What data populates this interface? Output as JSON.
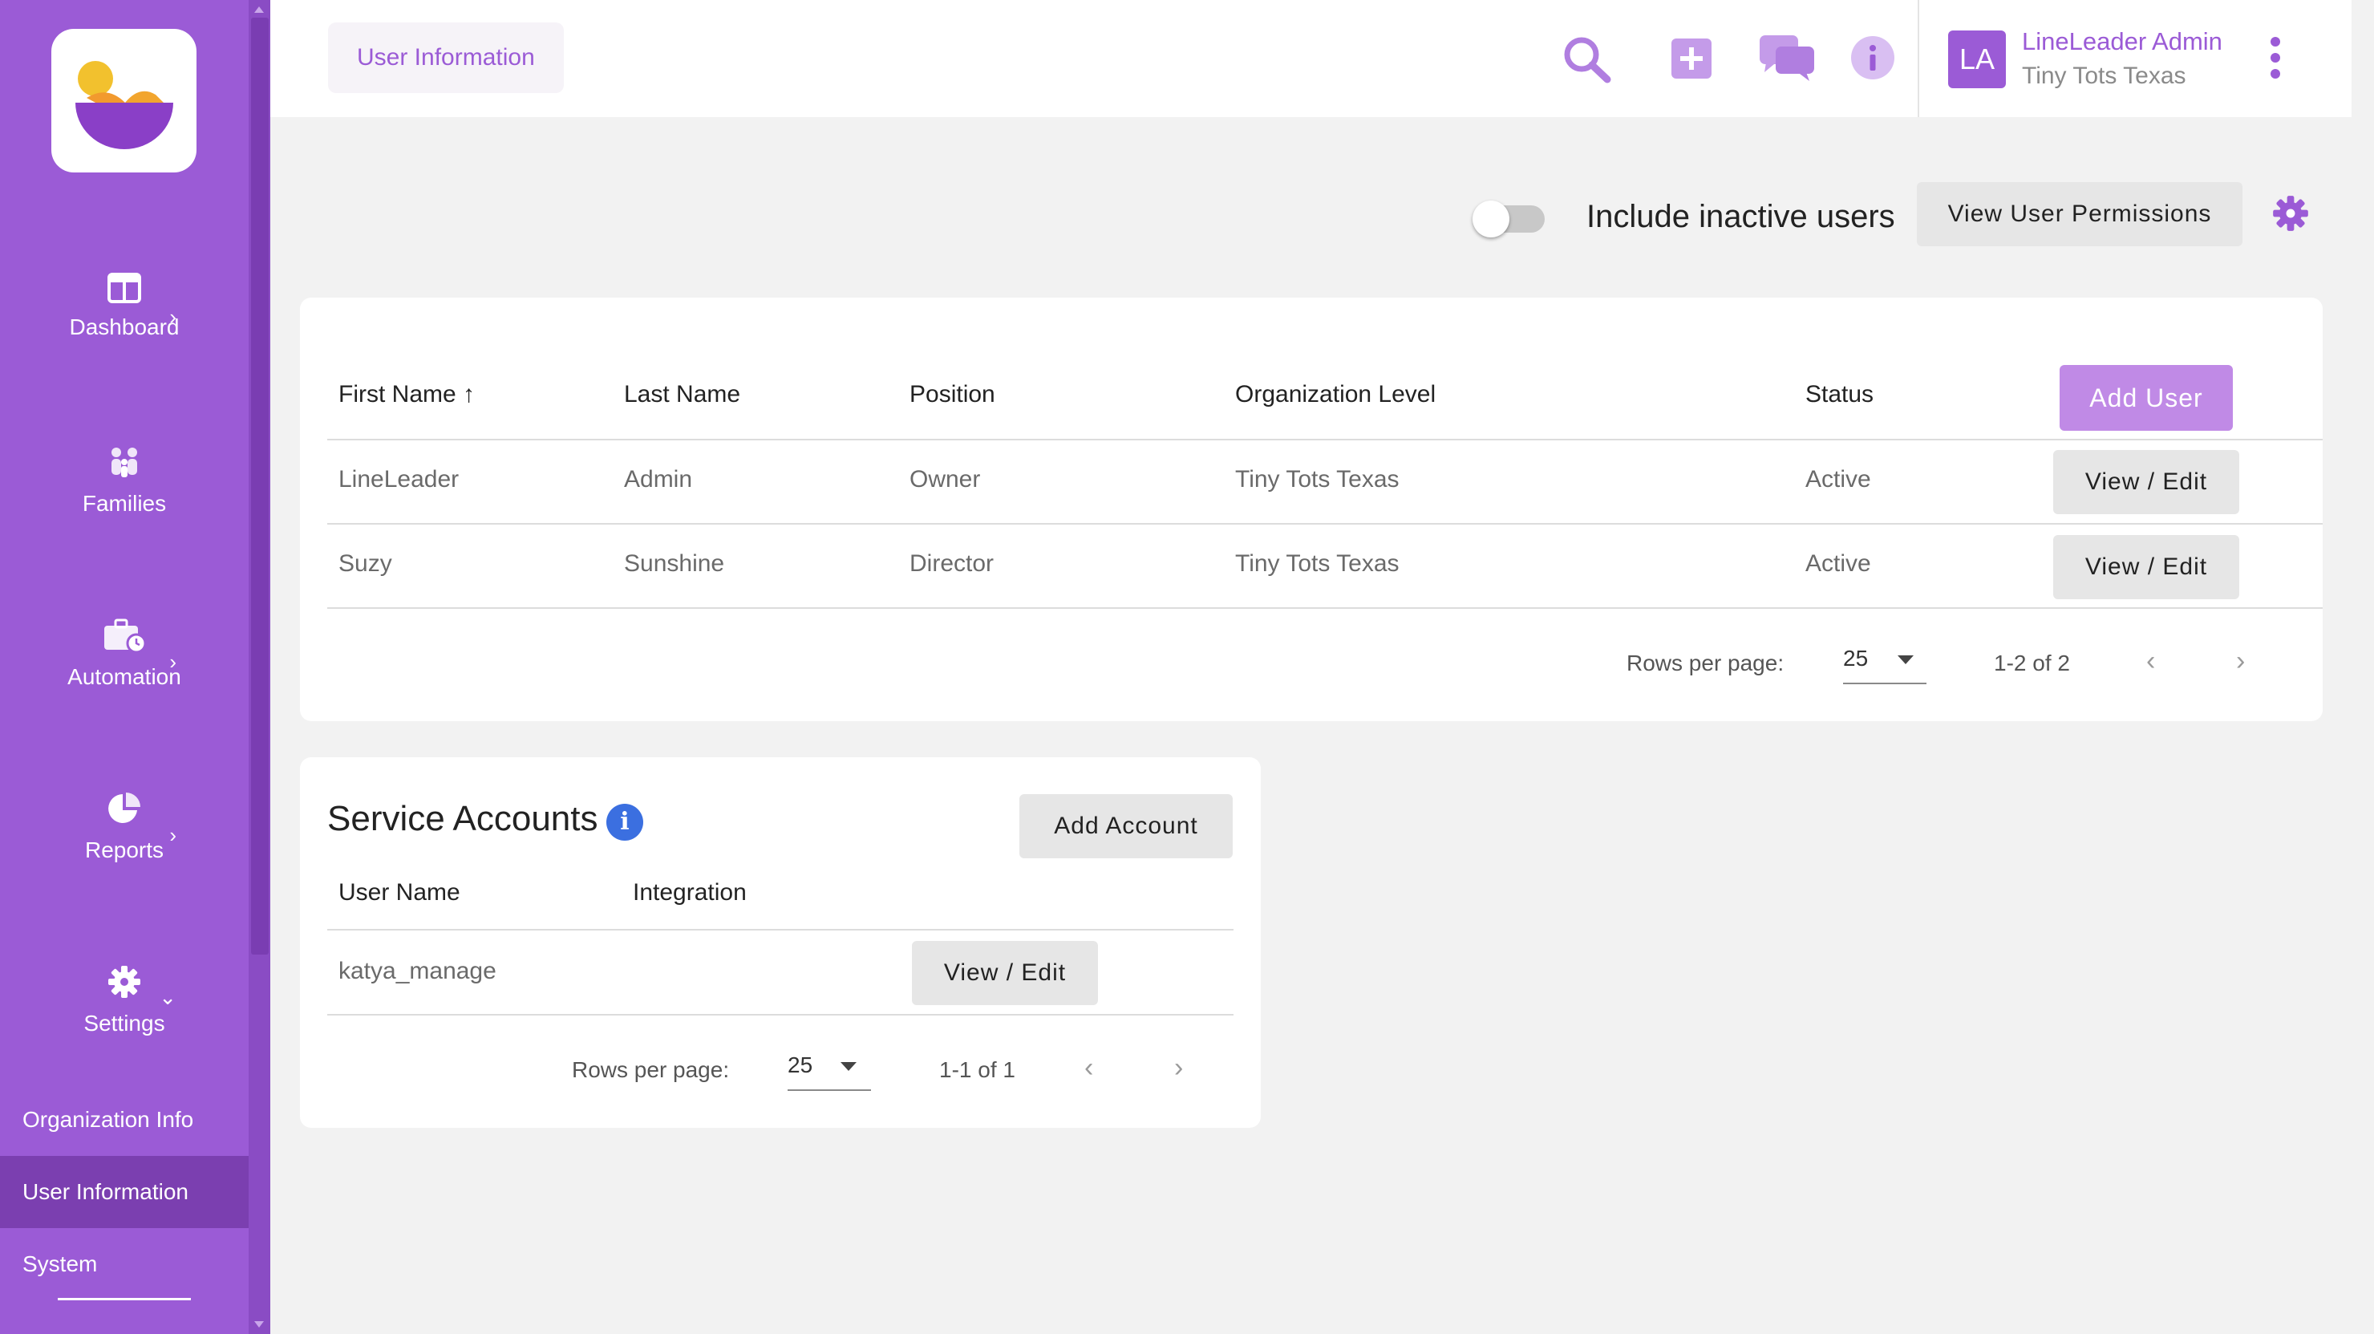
{
  "sidebar": {
    "nav": [
      {
        "label": "Dashboard",
        "icon": "dashboard-icon",
        "chevron": "›"
      },
      {
        "label": "Families",
        "icon": "families-icon",
        "chevron": ""
      },
      {
        "label": "Automation",
        "icon": "automation-icon",
        "chevron": "›"
      },
      {
        "label": "Reports",
        "icon": "reports-icon",
        "chevron": "›"
      },
      {
        "label": "Settings",
        "icon": "gear-icon",
        "chevron": "⌄"
      }
    ],
    "settings_sub": [
      {
        "label": "Organization Info"
      },
      {
        "label": "User Information",
        "active": true
      },
      {
        "label": "System"
      }
    ]
  },
  "header": {
    "page_title": "User Information",
    "icons": [
      "search-icon",
      "add-icon",
      "chat-icon",
      "info-icon"
    ],
    "user": {
      "initials": "LA",
      "name": "LineLeader Admin",
      "org": "Tiny Tots Texas"
    }
  },
  "controls": {
    "include_inactive_label": "Include inactive users",
    "include_inactive_on": false,
    "view_permissions_label": "View User Permissions"
  },
  "users_table": {
    "columns": [
      "First Name",
      "Last Name",
      "Position",
      "Organization Level",
      "Status"
    ],
    "sort_indicator": "↑",
    "add_label": "Add User",
    "rows": [
      {
        "first": "LineLeader",
        "last": "Admin",
        "position": "Owner",
        "org": "Tiny Tots Texas",
        "status": "Active",
        "action": "View / Edit"
      },
      {
        "first": "Suzy",
        "last": "Sunshine",
        "position": "Director",
        "org": "Tiny Tots Texas",
        "status": "Active",
        "action": "View / Edit"
      }
    ],
    "pager": {
      "rows_label": "Rows per page:",
      "rows_value": "25",
      "range": "1-2 of 2"
    }
  },
  "service_accounts": {
    "title": "Service Accounts",
    "info_glyph": "i",
    "add_label": "Add Account",
    "columns": [
      "User Name",
      "Integration"
    ],
    "rows": [
      {
        "user": "katya_manage",
        "integration": "",
        "action": "View / Edit"
      }
    ],
    "pager": {
      "rows_label": "Rows per page:",
      "rows_value": "25",
      "range": "1-1 of 1"
    }
  },
  "colors": {
    "brand": "#9b5bd6",
    "brand_dark": "#7b3fb0",
    "accent_light": "#c08ae6",
    "info_blue": "#3b6fe0"
  }
}
